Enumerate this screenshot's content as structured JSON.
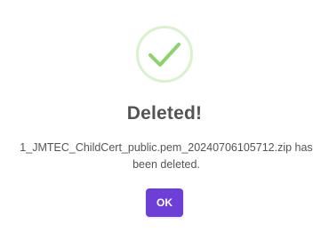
{
  "dialog": {
    "icon": "success-check-icon",
    "title": "Deleted!",
    "message": "1_JMTEC_ChildCert_public.pem_20240706105712.zip has been deleted.",
    "ok_label": "OK"
  },
  "colors": {
    "success_green": "#8bd36a",
    "success_ring": "#d9f1cc",
    "button_purple": "#6c3fd6",
    "text_gray": "#545454"
  }
}
